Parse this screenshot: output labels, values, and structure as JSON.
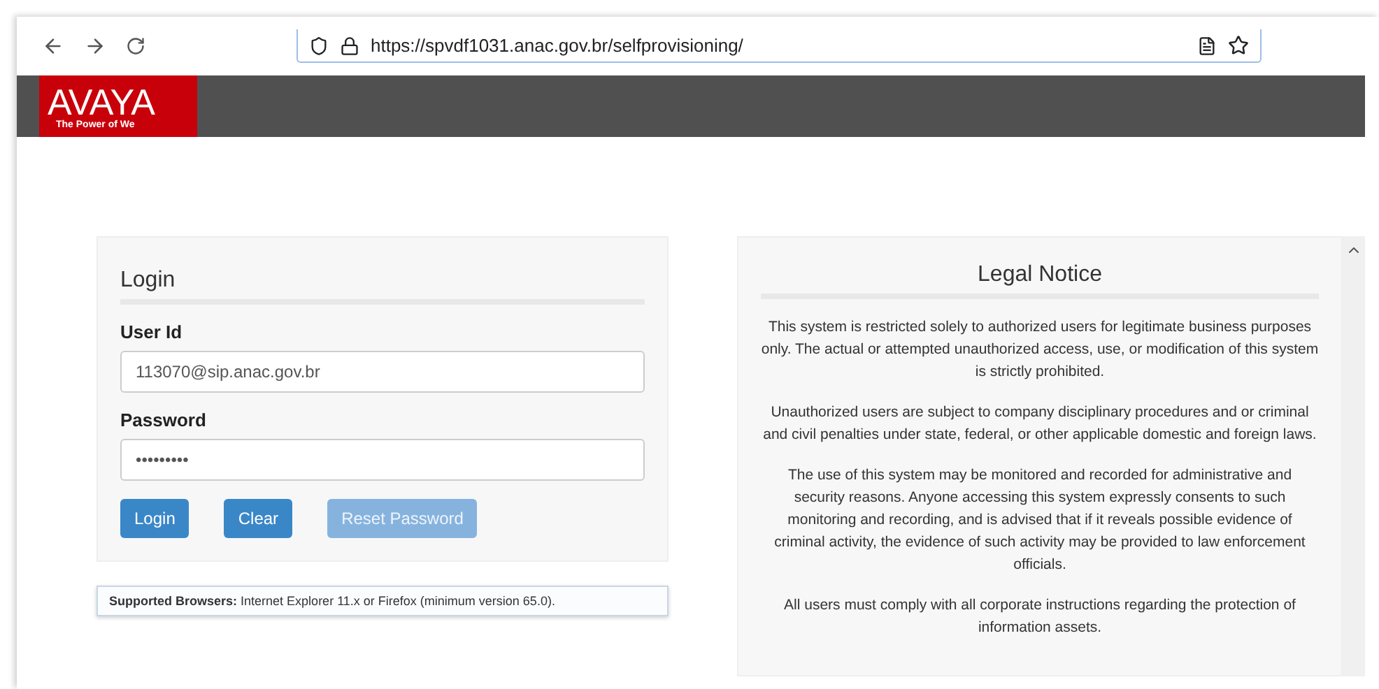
{
  "browser": {
    "url": "https://spvdf1031.anac.gov.br/selfprovisioning/"
  },
  "header": {
    "logo": "AVAYA",
    "tagline": "The Power of We"
  },
  "login": {
    "title": "Login",
    "fields": [
      {
        "label": "User Id",
        "value": "113070@sip.anac.gov.br"
      },
      {
        "label": "Password",
        "value": "•••••••••"
      }
    ],
    "buttons": [
      {
        "label": "Login",
        "disabled": false
      },
      {
        "label": "Clear",
        "disabled": false
      },
      {
        "label": "Reset Password",
        "disabled": true
      }
    ]
  },
  "supported_browsers": {
    "label": "Supported Browsers:",
    "text": "Internet Explorer 11.x or Firefox (minimum version 65.0)."
  },
  "legal_notice": {
    "title": "Legal Notice",
    "paragraphs": [
      "This system is restricted solely to authorized users for legitimate business purposes only. The actual or attempted unauthorized access, use, or modification of this system is strictly prohibited.",
      "Unauthorized users are subject to company disciplinary procedures and or criminal and civil penalties under state, federal, or other applicable domestic and foreign laws.",
      "The use of this system may be monitored and recorded for administrative and security reasons. Anyone accessing this system expressly consents to such monitoring and recording, and is advised that if it reveals possible evidence of criminal activity, the evidence of such activity may be provided to law enforcement officials.",
      "All users must comply with all corporate instructions regarding the protection of information assets."
    ]
  }
}
